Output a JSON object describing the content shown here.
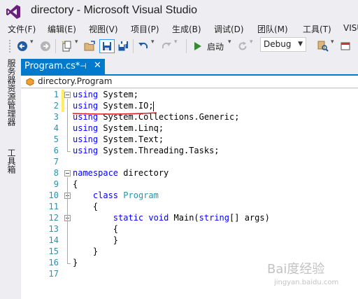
{
  "window": {
    "title": "directory - Microsoft Visual Studio"
  },
  "menu": {
    "items": [
      "文件(F)",
      "编辑(E)",
      "视图(V)",
      "项目(P)",
      "生成(B)",
      "调试(D)",
      "团队(M)",
      "工具(T)",
      "VISU"
    ]
  },
  "toolbar": {
    "start_label": "启动",
    "configuration": "Debug"
  },
  "side_tabs": [
    "服务器资源管理器",
    "工具箱"
  ],
  "document": {
    "tab_label": "Program.cs*",
    "pin_glyph": "⊣",
    "close_glyph": "✕",
    "nav_label": "directory.Program"
  },
  "editor": {
    "lines": [
      {
        "n": "1",
        "segs": [
          [
            "kw",
            "using"
          ],
          [
            "t",
            " System;"
          ]
        ]
      },
      {
        "n": "2",
        "segs": [
          [
            "kw",
            "using"
          ],
          [
            "t",
            " System.IO;"
          ]
        ]
      },
      {
        "n": "3",
        "segs": [
          [
            "kw",
            "using"
          ],
          [
            "t",
            " System.Collections.Generic;"
          ]
        ]
      },
      {
        "n": "4",
        "segs": [
          [
            "kw",
            "using"
          ],
          [
            "t",
            " System.Linq;"
          ]
        ]
      },
      {
        "n": "5",
        "segs": [
          [
            "kw",
            "using"
          ],
          [
            "t",
            " System.Text;"
          ]
        ]
      },
      {
        "n": "6",
        "segs": [
          [
            "kw",
            "using"
          ],
          [
            "t",
            " System.Threading.Tasks;"
          ]
        ]
      },
      {
        "n": "7",
        "segs": []
      },
      {
        "n": "8",
        "segs": [
          [
            "kw",
            "namespace"
          ],
          [
            "t",
            " directory"
          ]
        ]
      },
      {
        "n": "9",
        "segs": [
          [
            "t",
            "{"
          ]
        ]
      },
      {
        "n": "10",
        "segs": [
          [
            "t",
            "    "
          ],
          [
            "kw",
            "class"
          ],
          [
            "t",
            " "
          ],
          [
            "ty",
            "Program"
          ]
        ]
      },
      {
        "n": "11",
        "segs": [
          [
            "t",
            "    {"
          ]
        ]
      },
      {
        "n": "12",
        "segs": [
          [
            "t",
            "        "
          ],
          [
            "kw",
            "static"
          ],
          [
            "t",
            " "
          ],
          [
            "kw",
            "void"
          ],
          [
            "t",
            " Main("
          ],
          [
            "kw",
            "string"
          ],
          [
            "t",
            "[] args)"
          ]
        ]
      },
      {
        "n": "13",
        "segs": [
          [
            "t",
            "        {"
          ]
        ]
      },
      {
        "n": "14",
        "segs": [
          [
            "t",
            "        }"
          ]
        ]
      },
      {
        "n": "15",
        "segs": [
          [
            "t",
            "    }"
          ]
        ]
      },
      {
        "n": "16",
        "segs": [
          [
            "t",
            "}"
          ]
        ]
      },
      {
        "n": "17",
        "segs": []
      }
    ]
  },
  "watermark": {
    "text": "Bai度经验",
    "sub": "jingyan.baidu.com"
  },
  "colors": {
    "accent": "#007acc",
    "keyword": "#0000ff",
    "type": "#2b91af",
    "line_number": "#2b91af",
    "change_marker": "#ffee62",
    "annotation_underline": "#e02020",
    "vs_logo": "#68217a"
  }
}
